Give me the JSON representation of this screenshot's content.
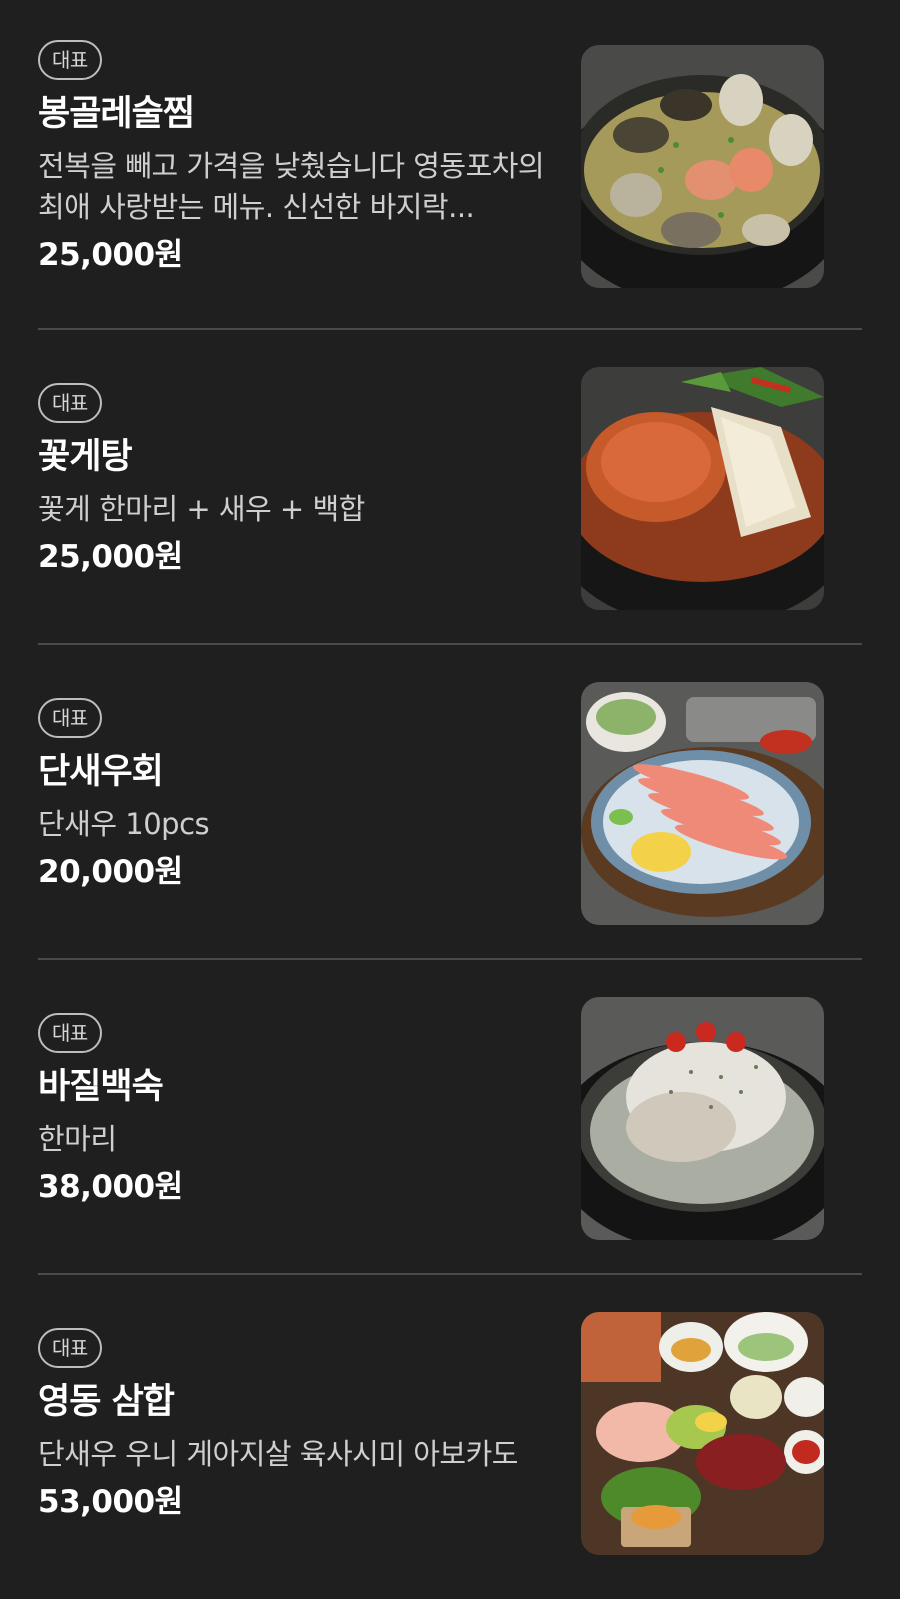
{
  "menu": {
    "items": [
      {
        "badge": "대표",
        "name": "봉골레술찜",
        "description": "전복을 빼고 가격을 낮췄습니다 영동포차의 최애 사랑받는 메뉴. 신선한 바지락...",
        "price": "25,000원",
        "image_icon": "clam-steamed-dish-photo"
      },
      {
        "badge": "대표",
        "name": "꽃게탕",
        "description": "꽃게 한마리 + 새우 + 백합",
        "price": "25,000원",
        "image_icon": "crab-stew-photo"
      },
      {
        "badge": "대표",
        "name": "단새우회",
        "description": "단새우 10pcs",
        "price": "20,000원",
        "image_icon": "sweet-shrimp-sashimi-photo"
      },
      {
        "badge": "대표",
        "name": "바질백숙",
        "description": "한마리",
        "price": "38,000원",
        "image_icon": "basil-chicken-soup-photo"
      },
      {
        "badge": "대표",
        "name": "영동 삼합",
        "description": "단새우 우니 게아지살 육사시미 아보카도",
        "price": "53,000원",
        "image_icon": "seafood-platter-photo"
      }
    ]
  },
  "colors": {
    "background": "#1f1f1f",
    "divider": "#4a4a4a",
    "badge_border": "#bdbdbd",
    "text_primary": "#ffffff",
    "text_secondary": "#cfcfcf"
  }
}
